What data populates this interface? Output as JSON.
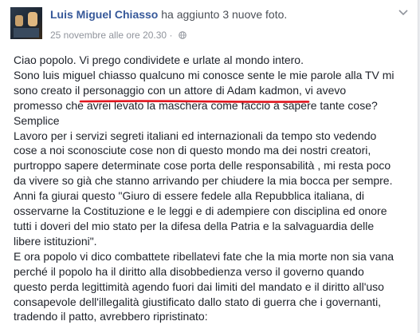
{
  "post": {
    "author_name": "Luis Miguel Chiasso",
    "action_text": "ha aggiunto 3 nuove foto.",
    "timestamp": "25 novembre alle ore 20.30",
    "separator": "·",
    "privacy_icon": "globe-icon",
    "menu_icon": "chevron-down-icon",
    "underline_color": "#e0151e",
    "lines": [
      "Ciao popolo. Vi prego condividete e urlate al mondo intero.",
      "Sono luis miguel chiasso qualcuno mi conosce sente le mie parole alla TV mi",
      "sono creato il personaggio con un attore di Adam kadmon, vi avevo",
      "promesso che avrei levato la maschera come faccio a sapere tante cose?",
      "Semplice",
      "Lavoro per i servizi segreti italiani ed internazionali da tempo sto vedendo",
      "cose a noi sconosciute cose non di questo mondo ma dei nostri creatori,",
      "purtroppo sapere determinate cose porta delle responsabilità , mi resta poco",
      "da vivere so già che stanno arrivando per chiudere la mia bocca per sempre.",
      "Anni fa giurai questo \"Giuro di essere fedele alla Repubblica italiana, di",
      "osservarne la Costituzione e le leggi e di adempiere con disciplina ed onore",
      "tutti i doveri del mio stato per la difesa della Patria e la salvaguardia delle",
      "libere istituzioni\".",
      "E ora popolo vi dico combattete ribellatevi fate che la mia morte non sia vana",
      "perché il popolo ha il diritto alla disobbedienza verso il governo quando",
      "questo perda legittimità agendo fuori dai limiti del mandato e il diritto all'uso",
      "consapevole dell'illegalità giustificato dallo stato di guerra che i governanti,",
      "tradendo il patto, avrebbero ripristinato:"
    ]
  }
}
